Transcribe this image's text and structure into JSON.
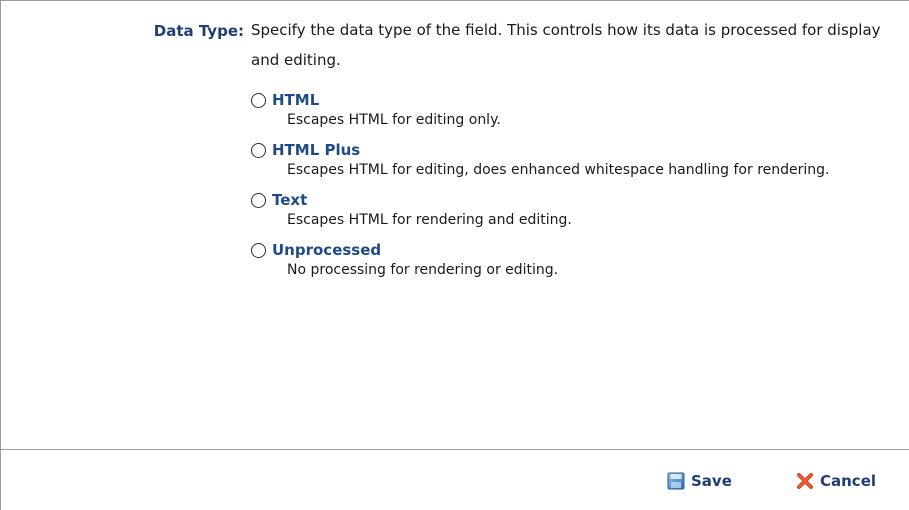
{
  "field": {
    "label": "Data Type:",
    "description": "Specify the data type of the field. This controls how its data is processed for display and editing."
  },
  "options": [
    {
      "label": "HTML",
      "description": "Escapes HTML for editing only.",
      "selected": false
    },
    {
      "label": "HTML Plus",
      "description": "Escapes HTML for editing, does enhanced whitespace handling for rendering.",
      "selected": false
    },
    {
      "label": "Text",
      "description": "Escapes HTML for rendering and editing.",
      "selected": false
    },
    {
      "label": "Unprocessed",
      "description": "No processing for rendering or editing.",
      "selected": false
    }
  ],
  "footer": {
    "save_label": "Save",
    "save_icon": "save-icon",
    "cancel_label": "Cancel",
    "cancel_icon": "cancel-icon"
  },
  "colors": {
    "label_blue": "#1f3f73",
    "option_blue": "#1f4a87",
    "cancel_x_red": "#d9431e"
  }
}
